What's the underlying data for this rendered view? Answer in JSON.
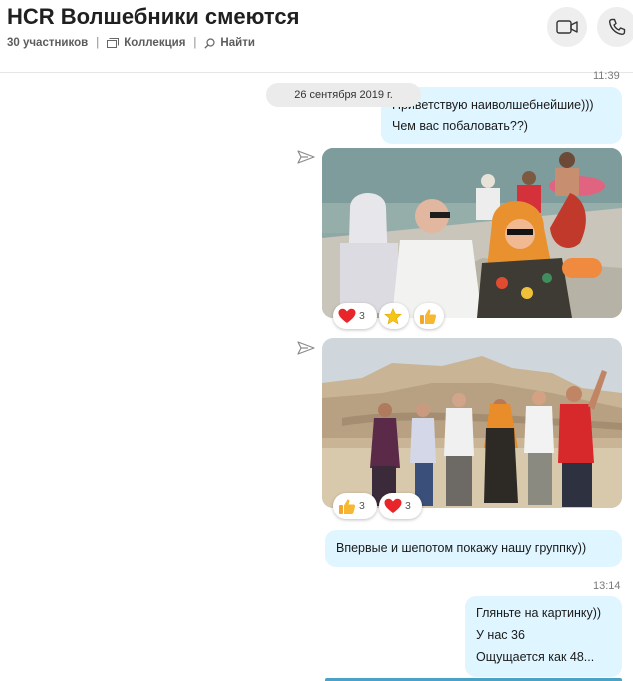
{
  "chat": {
    "title": "HCR Волшебники смеются",
    "participants": "30 участников",
    "gallery_label": "Коллекция",
    "find_label": "Найти",
    "video_call_icon": "video-camera-icon",
    "audio_call_icon": "phone-icon"
  },
  "messages": {
    "time_first": "11:39",
    "date_divider": "26 сентября 2019 г.",
    "msg1_line1": "Приветствую наиволшебнейшие)))",
    "msg1_line2": "Чем вас побаловать??)",
    "photo1_reactions": [
      {
        "icon": "heart-icon",
        "count": "3"
      },
      {
        "icon": "star-icon",
        "count": ""
      },
      {
        "icon": "thumbs-up-icon",
        "count": ""
      }
    ],
    "photo2_reactions": [
      {
        "icon": "thumbs-up-icon",
        "count": "3"
      },
      {
        "icon": "heart-icon",
        "count": "3"
      }
    ],
    "msg2": "Впервые и шепотом покажу нашу группку))",
    "time_second": "13:14",
    "msg3_line1": "Гляньте на картинку))",
    "msg3_line2": "У нас 36",
    "msg3_line3": "Ощущается как 48..."
  },
  "colors": {
    "bubble": "#dff5ff",
    "heart": "#e8252a",
    "star": "#f5c518",
    "thumb": "#f7b733"
  }
}
